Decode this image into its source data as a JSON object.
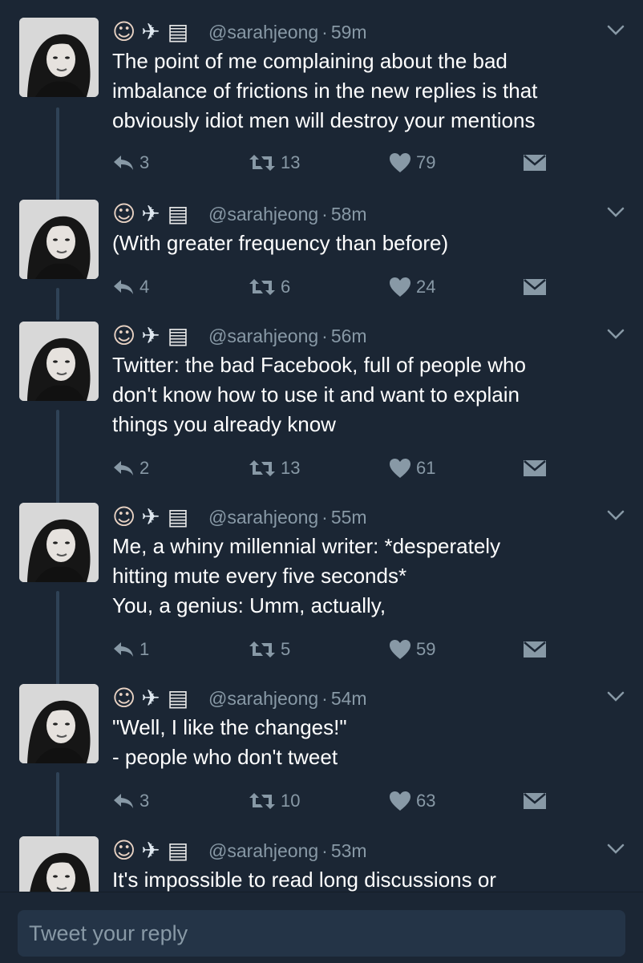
{
  "colors": {
    "background": "#1b2634",
    "text_secondary": "#8899a6",
    "thread_line": "#2f4256",
    "input_background": "#243447"
  },
  "tweets": [
    {
      "emoji_icons": [
        "woman-technologist-icon",
        "airplane-icon",
        "document-icon"
      ],
      "handle": "@sarahjeong",
      "time": "59m",
      "text_lines": [
        "The point of me complaining about the bad",
        "imbalance of frictions in the new replies is that",
        "obviously idiot men will destroy your mentions"
      ],
      "replies": "3",
      "retweets": "13",
      "likes": "79"
    },
    {
      "emoji_icons": [
        "woman-technologist-icon",
        "airplane-icon",
        "document-icon"
      ],
      "handle": "@sarahjeong",
      "time": "58m",
      "text_lines": [
        "(With greater frequency than before)"
      ],
      "replies": "4",
      "retweets": "6",
      "likes": "24"
    },
    {
      "emoji_icons": [
        "woman-technologist-icon",
        "airplane-icon",
        "document-icon"
      ],
      "handle": "@sarahjeong",
      "time": "56m",
      "text_lines": [
        "Twitter: the bad Facebook, full of people who",
        "don't know how to use it and want to explain",
        "things you already know"
      ],
      "replies": "2",
      "retweets": "13",
      "likes": "61"
    },
    {
      "emoji_icons": [
        "woman-technologist-icon",
        "airplane-icon",
        "document-icon"
      ],
      "handle": "@sarahjeong",
      "time": "55m",
      "text_lines": [
        "Me, a whiny millennial writer: *desperately",
        "hitting mute every five seconds*",
        "You, a genius: Umm, actually,"
      ],
      "replies": "1",
      "retweets": "5",
      "likes": "59"
    },
    {
      "emoji_icons": [
        "woman-technologist-icon",
        "airplane-icon",
        "document-icon"
      ],
      "handle": "@sarahjeong",
      "time": "54m",
      "text_lines": [
        "\"Well, I like the changes!\"",
        "- people who don't tweet"
      ],
      "replies": "3",
      "retweets": "10",
      "likes": "63"
    },
    {
      "emoji_icons": [
        "woman-technologist-icon",
        "airplane-icon",
        "document-icon"
      ],
      "handle": "@sarahjeong",
      "time": "53m",
      "text_lines": [
        "It's impossible to read long discussions or"
      ]
    }
  ],
  "separator": "·",
  "emoji_glyphs": {
    "person": "☺",
    "plane": "✈",
    "doc": "▤"
  },
  "reply_box": {
    "placeholder": "Tweet your reply"
  }
}
